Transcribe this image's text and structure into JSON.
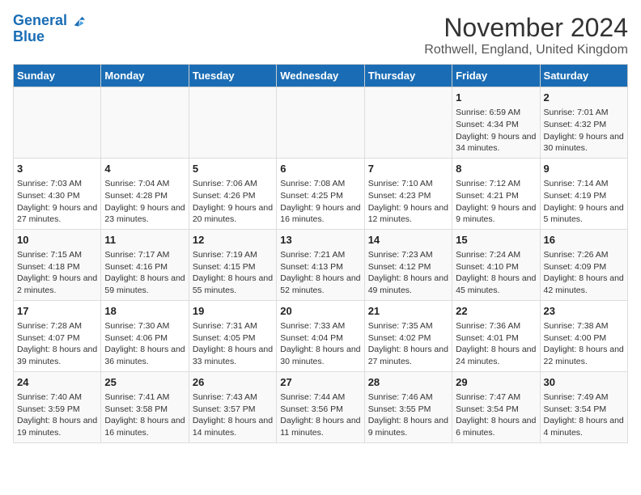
{
  "logo": {
    "line1": "General",
    "line2": "Blue"
  },
  "title": "November 2024",
  "subtitle": "Rothwell, England, United Kingdom",
  "headers": [
    "Sunday",
    "Monday",
    "Tuesday",
    "Wednesday",
    "Thursday",
    "Friday",
    "Saturday"
  ],
  "weeks": [
    [
      {
        "day": "",
        "info": ""
      },
      {
        "day": "",
        "info": ""
      },
      {
        "day": "",
        "info": ""
      },
      {
        "day": "",
        "info": ""
      },
      {
        "day": "",
        "info": ""
      },
      {
        "day": "1",
        "info": "Sunrise: 6:59 AM\nSunset: 4:34 PM\nDaylight: 9 hours and 34 minutes."
      },
      {
        "day": "2",
        "info": "Sunrise: 7:01 AM\nSunset: 4:32 PM\nDaylight: 9 hours and 30 minutes."
      }
    ],
    [
      {
        "day": "3",
        "info": "Sunrise: 7:03 AM\nSunset: 4:30 PM\nDaylight: 9 hours and 27 minutes."
      },
      {
        "day": "4",
        "info": "Sunrise: 7:04 AM\nSunset: 4:28 PM\nDaylight: 9 hours and 23 minutes."
      },
      {
        "day": "5",
        "info": "Sunrise: 7:06 AM\nSunset: 4:26 PM\nDaylight: 9 hours and 20 minutes."
      },
      {
        "day": "6",
        "info": "Sunrise: 7:08 AM\nSunset: 4:25 PM\nDaylight: 9 hours and 16 minutes."
      },
      {
        "day": "7",
        "info": "Sunrise: 7:10 AM\nSunset: 4:23 PM\nDaylight: 9 hours and 12 minutes."
      },
      {
        "day": "8",
        "info": "Sunrise: 7:12 AM\nSunset: 4:21 PM\nDaylight: 9 hours and 9 minutes."
      },
      {
        "day": "9",
        "info": "Sunrise: 7:14 AM\nSunset: 4:19 PM\nDaylight: 9 hours and 5 minutes."
      }
    ],
    [
      {
        "day": "10",
        "info": "Sunrise: 7:15 AM\nSunset: 4:18 PM\nDaylight: 9 hours and 2 minutes."
      },
      {
        "day": "11",
        "info": "Sunrise: 7:17 AM\nSunset: 4:16 PM\nDaylight: 8 hours and 59 minutes."
      },
      {
        "day": "12",
        "info": "Sunrise: 7:19 AM\nSunset: 4:15 PM\nDaylight: 8 hours and 55 minutes."
      },
      {
        "day": "13",
        "info": "Sunrise: 7:21 AM\nSunset: 4:13 PM\nDaylight: 8 hours and 52 minutes."
      },
      {
        "day": "14",
        "info": "Sunrise: 7:23 AM\nSunset: 4:12 PM\nDaylight: 8 hours and 49 minutes."
      },
      {
        "day": "15",
        "info": "Sunrise: 7:24 AM\nSunset: 4:10 PM\nDaylight: 8 hours and 45 minutes."
      },
      {
        "day": "16",
        "info": "Sunrise: 7:26 AM\nSunset: 4:09 PM\nDaylight: 8 hours and 42 minutes."
      }
    ],
    [
      {
        "day": "17",
        "info": "Sunrise: 7:28 AM\nSunset: 4:07 PM\nDaylight: 8 hours and 39 minutes."
      },
      {
        "day": "18",
        "info": "Sunrise: 7:30 AM\nSunset: 4:06 PM\nDaylight: 8 hours and 36 minutes."
      },
      {
        "day": "19",
        "info": "Sunrise: 7:31 AM\nSunset: 4:05 PM\nDaylight: 8 hours and 33 minutes."
      },
      {
        "day": "20",
        "info": "Sunrise: 7:33 AM\nSunset: 4:04 PM\nDaylight: 8 hours and 30 minutes."
      },
      {
        "day": "21",
        "info": "Sunrise: 7:35 AM\nSunset: 4:02 PM\nDaylight: 8 hours and 27 minutes."
      },
      {
        "day": "22",
        "info": "Sunrise: 7:36 AM\nSunset: 4:01 PM\nDaylight: 8 hours and 24 minutes."
      },
      {
        "day": "23",
        "info": "Sunrise: 7:38 AM\nSunset: 4:00 PM\nDaylight: 8 hours and 22 minutes."
      }
    ],
    [
      {
        "day": "24",
        "info": "Sunrise: 7:40 AM\nSunset: 3:59 PM\nDaylight: 8 hours and 19 minutes."
      },
      {
        "day": "25",
        "info": "Sunrise: 7:41 AM\nSunset: 3:58 PM\nDaylight: 8 hours and 16 minutes."
      },
      {
        "day": "26",
        "info": "Sunrise: 7:43 AM\nSunset: 3:57 PM\nDaylight: 8 hours and 14 minutes."
      },
      {
        "day": "27",
        "info": "Sunrise: 7:44 AM\nSunset: 3:56 PM\nDaylight: 8 hours and 11 minutes."
      },
      {
        "day": "28",
        "info": "Sunrise: 7:46 AM\nSunset: 3:55 PM\nDaylight: 8 hours and 9 minutes."
      },
      {
        "day": "29",
        "info": "Sunrise: 7:47 AM\nSunset: 3:54 PM\nDaylight: 8 hours and 6 minutes."
      },
      {
        "day": "30",
        "info": "Sunrise: 7:49 AM\nSunset: 3:54 PM\nDaylight: 8 hours and 4 minutes."
      }
    ]
  ]
}
